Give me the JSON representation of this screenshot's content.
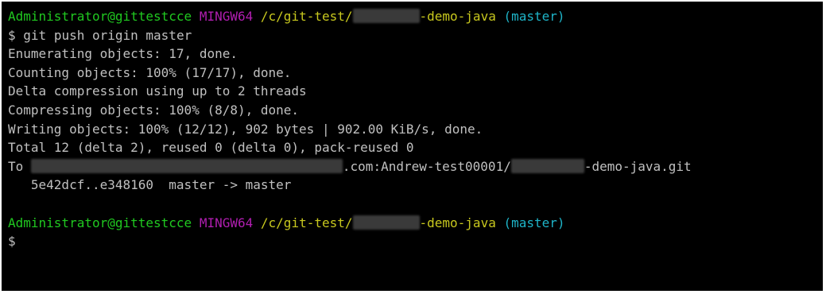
{
  "colors": {
    "background": "#000000",
    "text": "#c0c0c0",
    "user_host": "#20c820",
    "mingw": "#b01eb0",
    "path": "#c8c81e",
    "branch": "#1eb4c8"
  },
  "prompt": {
    "user_host": "Administrator@gittestcce",
    "env": "MINGW64",
    "path_prefix": "/c/git-test/",
    "path_suffix": "-demo-java",
    "branch": "(master)",
    "symbol": "$"
  },
  "command": "git push origin master",
  "output": [
    "Enumerating objects: 17, done.",
    "Counting objects: 100% (17/17), done.",
    "Delta compression using up to 2 threads",
    "Compressing objects: 100% (8/8), done.",
    "Writing objects: 100% (12/12), 902 bytes | 902.00 KiB/s, done.",
    "Total 12 (delta 2), reused 0 (delta 0), pack-reused 0"
  ],
  "remote": {
    "to_label": "To",
    "host_suffix": ".com:Andrew-test00001/",
    "repo_suffix": "-demo-java.git",
    "ref_update": "   5e42dcf..e348160  master -> master"
  }
}
